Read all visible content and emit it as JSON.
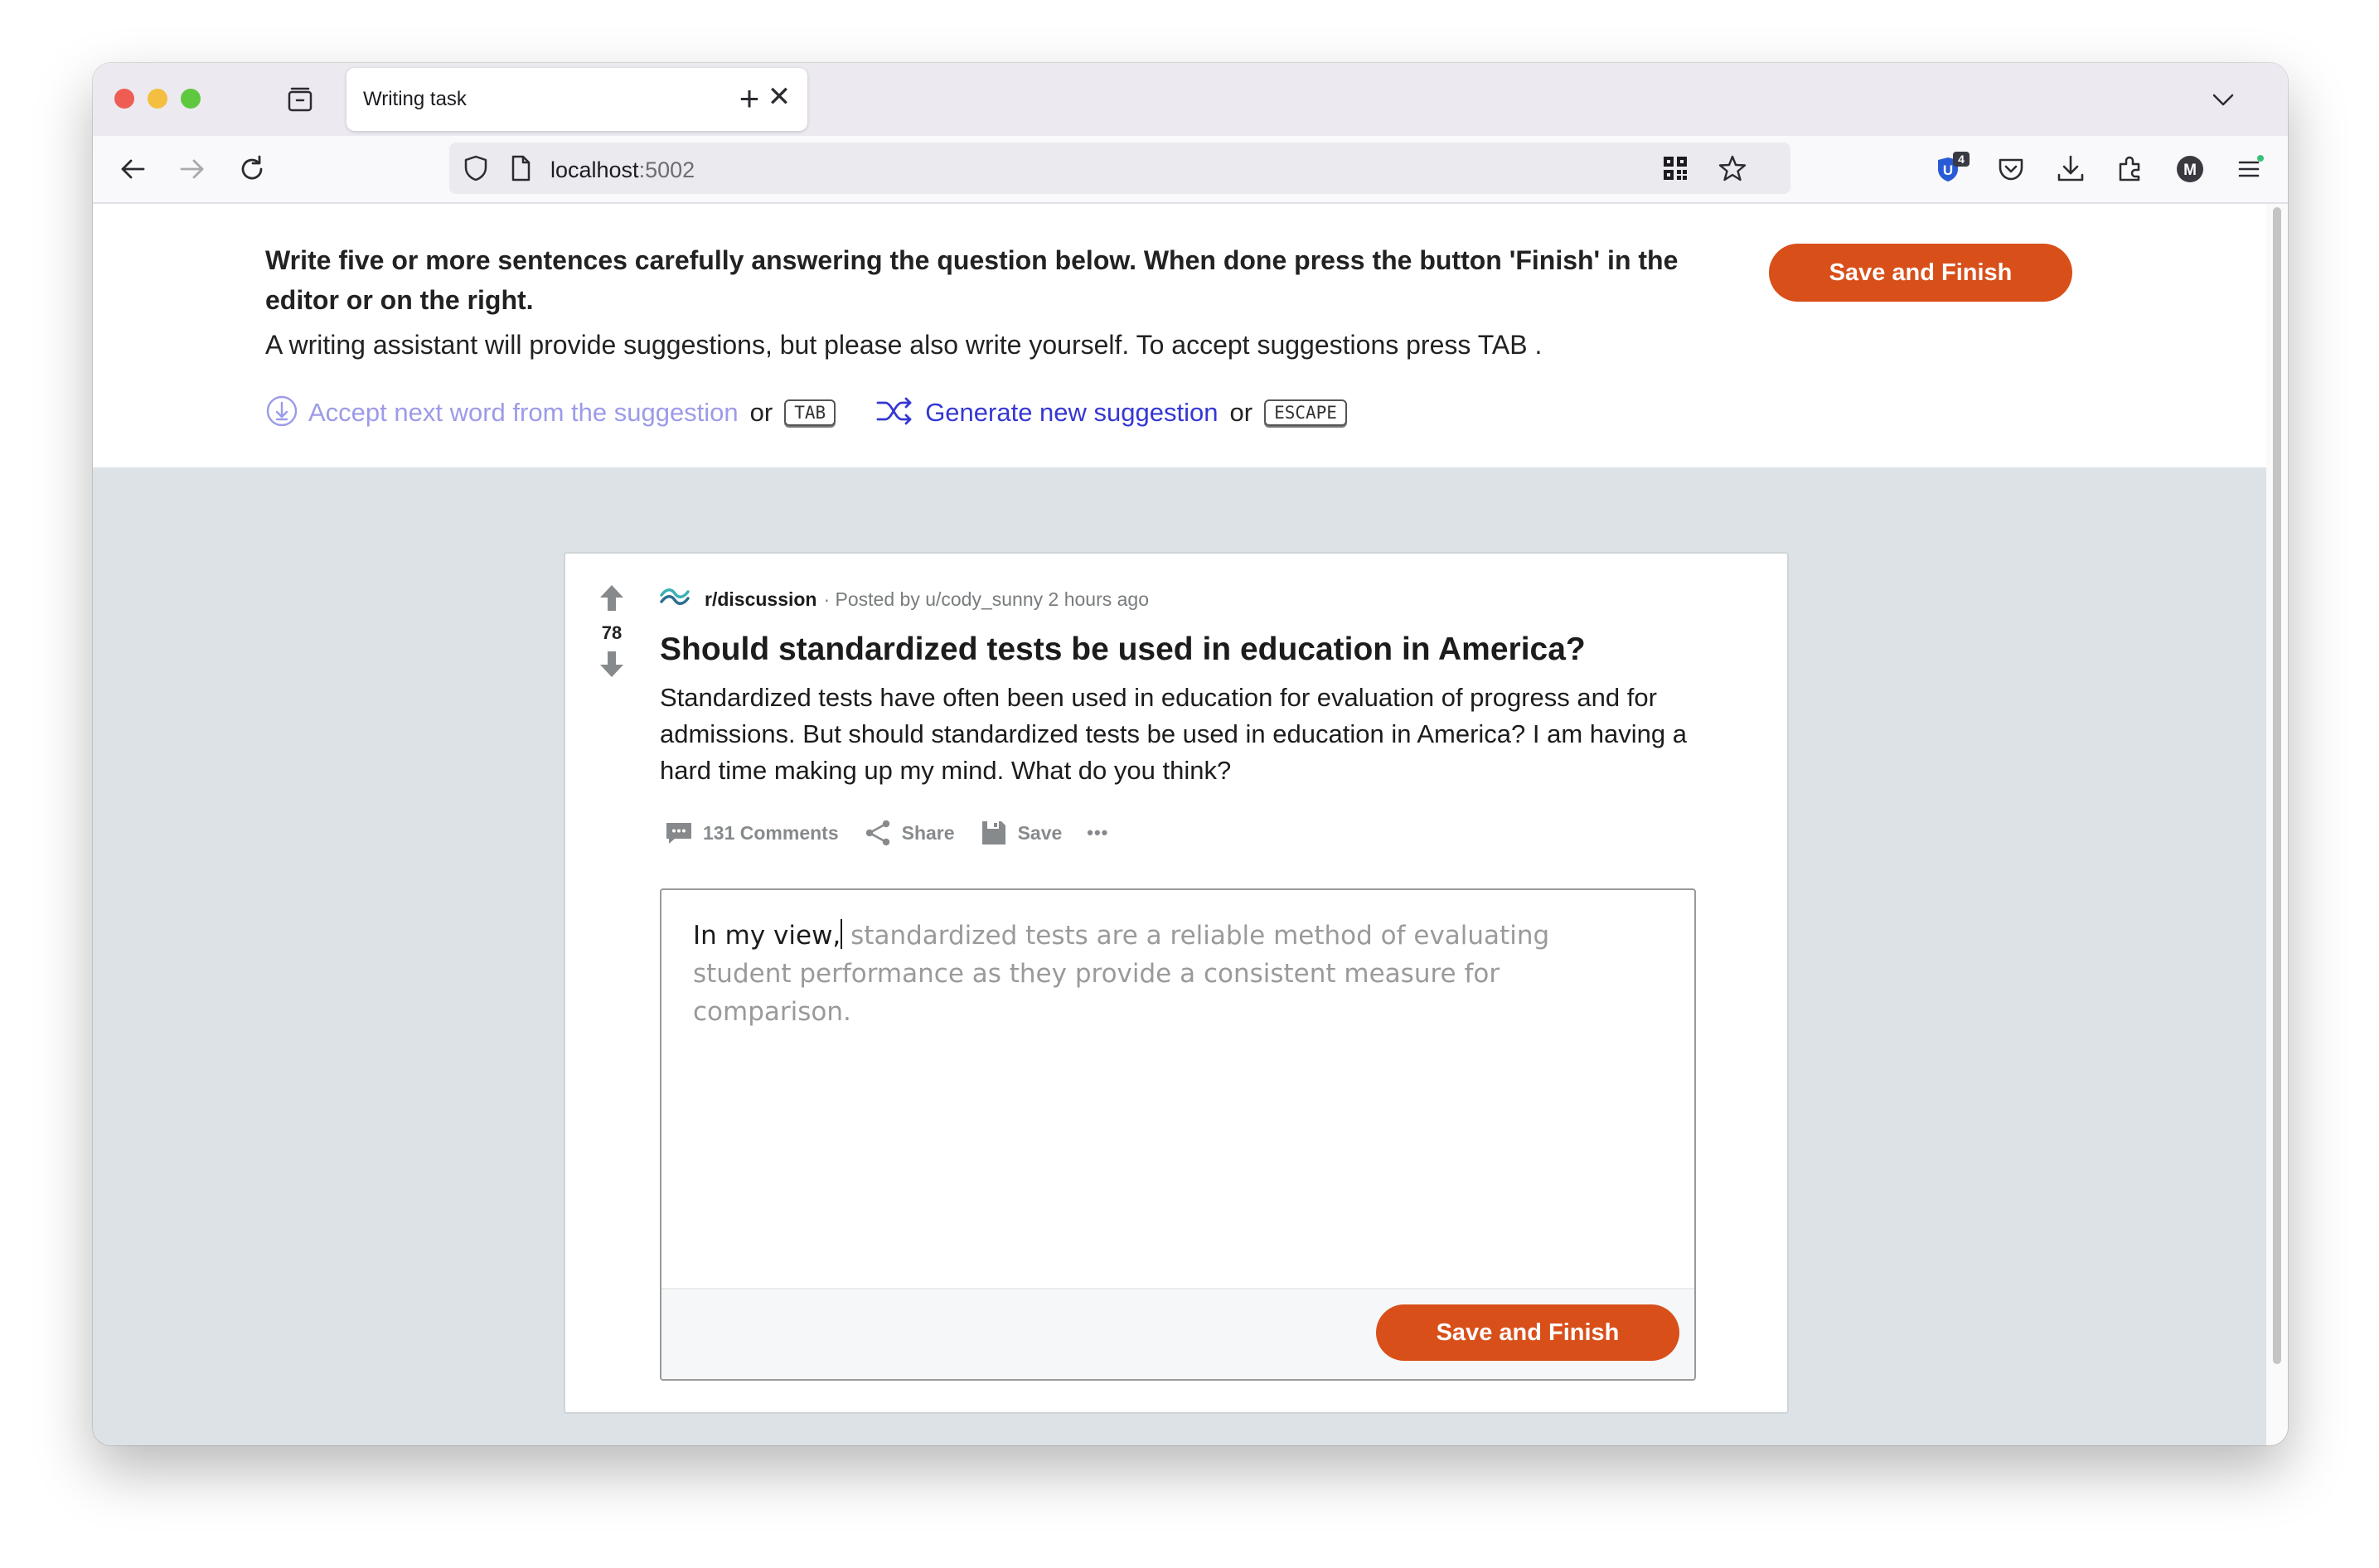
{
  "browser": {
    "tab_title": "Writing task",
    "close_glyph": "✕",
    "new_tab_glyph": "+",
    "url_host": "localhost",
    "url_port": ":5002",
    "extension_badge": "4",
    "account_initial": "M"
  },
  "instructions": {
    "title": "Write five or more sentences carefully answering the question below. When done press the button 'Finish' in the editor or on the right.",
    "body": "A writing assistant will provide suggestions, but please also write yourself. To accept suggestions press TAB .",
    "accept_hint": "Accept next word from the suggestion",
    "or_1": "or",
    "accept_key": "TAB",
    "generate_hint": "Generate new suggestion",
    "or_2": "or",
    "generate_key": "ESCAPE",
    "save_button": "Save and Finish"
  },
  "post": {
    "vote_count": "78",
    "subreddit": "r/discussion",
    "meta": "· Posted by u/cody_sunny 2 hours ago",
    "title": "Should standardized tests be used in education in America?",
    "body": "Standardized tests have often been used in education for evaluation of progress and for admissions. But should standardized tests be used in education in America? I am having a hard time making up my mind. What do you think?",
    "actions": {
      "comments": "131 Comments",
      "share": "Share",
      "save": "Save",
      "more": "•••"
    }
  },
  "editor": {
    "typed_text": "In my view,",
    "suggestion_text": " standardized tests are a reliable method of evaluating student performance as they provide a consistent measure for comparison.",
    "save_button": "Save and Finish"
  },
  "colors": {
    "accent": "#d84f1a",
    "hint_accept": "#9c9be8",
    "hint_generate": "#3537d3",
    "page_background": "#dde2e6"
  }
}
